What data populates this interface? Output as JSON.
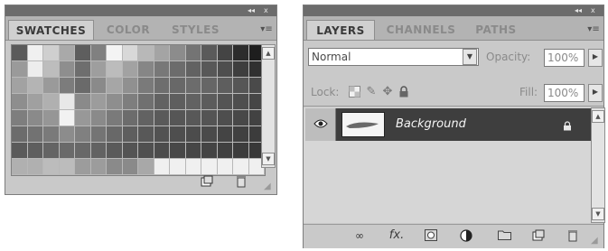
{
  "swatches_panel": {
    "collapse_glyph": "◂◂",
    "close_glyph": "x",
    "tabs": [
      {
        "label": "SWATCHES",
        "active": true
      },
      {
        "label": "COLOR",
        "active": false
      },
      {
        "label": "STYLES",
        "active": false
      }
    ],
    "menu_glyph": "▾≡",
    "swatch_gray_levels": [
      [
        "#5a5a5a",
        "#f0f0f0",
        "#cfcfcf",
        "#a9a9a9",
        "#5e5e5e",
        "#808080",
        "#f4f4f4",
        "#d8d8d8",
        "#b8b8b8",
        "#a4a4a4",
        "#8c8c8c",
        "#747474",
        "#5a5a5a",
        "#444444",
        "#2c2c2c",
        "#1e1e1e"
      ],
      [
        "#9a9a9a",
        "#ededed",
        "#bdbdbd",
        "#8e8e8e",
        "#6e6e6e",
        "#9e9e9e",
        "#bcbcbc",
        "#a2a2a2",
        "#868686",
        "#787878",
        "#6c6c6c",
        "#626262",
        "#585858",
        "#4e4e4e",
        "#3e3e3e",
        "#303030"
      ],
      [
        "#a2a2a2",
        "#b4b4b4",
        "#9a9a9a",
        "#7c7c7c",
        "#6a6a6a",
        "#8a8a8a",
        "#a6a6a6",
        "#909090",
        "#7a7a7a",
        "#6e6e6e",
        "#686868",
        "#6c6c6c",
        "#666666",
        "#5e5e5e",
        "#565656",
        "#4a4a4a"
      ],
      [
        "#8e8e8e",
        "#a0a0a0",
        "#b0b0b0",
        "#e8e8e8",
        "#8a8a8a",
        "#9c9c9c",
        "#8e8e8e",
        "#7e7e7e",
        "#707070",
        "#626262",
        "#5e5e5e",
        "#626262",
        "#5c5c5c",
        "#545454",
        "#4e4e4e",
        "#464646"
      ],
      [
        "#7e7e7e",
        "#8a8a8a",
        "#969696",
        "#f2f2f2",
        "#989898",
        "#8a8a8a",
        "#7a7a7a",
        "#6c6c6c",
        "#626262",
        "#5a5a5a",
        "#565656",
        "#585858",
        "#545454",
        "#4e4e4e",
        "#484848",
        "#424242"
      ],
      [
        "#6c6c6c",
        "#727272",
        "#7a7a7a",
        "#8c8c8c",
        "#808080",
        "#747474",
        "#686868",
        "#5e5e5e",
        "#585858",
        "#525252",
        "#4e4e4e",
        "#4c4c4c",
        "#4a4a4a",
        "#444444",
        "#404040",
        "#3c3c3c"
      ],
      [
        "#5a5a5a",
        "#5e5e5e",
        "#646464",
        "#6a6a6a",
        "#686868",
        "#626262",
        "#5a5a5a",
        "#545454",
        "#505050",
        "#4c4c4c",
        "#484848",
        "#464646",
        "#444444",
        "#404040",
        "#3c3c3c",
        "#383838"
      ],
      [
        "#b0b0b0",
        "#b0b0b0",
        "#bcbcbc",
        "#bcbcbc",
        "#9c9c9c",
        "#9c9c9c",
        "#8a8a8a",
        "#8a8a8a",
        "#a8a8a8",
        "#f0f0f0",
        "#f0f0f0",
        "#f0f0f0",
        "#f0f0f0",
        "#f0f0f0",
        "#f0f0f0",
        "#f0f0f0"
      ]
    ],
    "footer_icons": [
      "new-swatch-icon",
      "trash-icon"
    ]
  },
  "layers_panel": {
    "collapse_glyph": "◂◂",
    "close_glyph": "x",
    "tabs": [
      {
        "label": "LAYERS",
        "active": true
      },
      {
        "label": "CHANNELS",
        "active": false
      },
      {
        "label": "PATHS",
        "active": false
      }
    ],
    "menu_glyph": "▾≡",
    "blend_mode": "Normal",
    "opacity_label": "Opacity:",
    "opacity_value": "100%",
    "lock_label": "Lock:",
    "fill_label": "Fill:",
    "fill_value": "100%",
    "layers": [
      {
        "name": "Background",
        "visible": true,
        "locked": true
      }
    ],
    "footer_icons": [
      "link-layers-icon",
      "fx-icon",
      "mask-icon",
      "adjustment-icon",
      "group-icon",
      "new-layer-icon",
      "trash-icon"
    ],
    "fx_label": "fx."
  },
  "colors": {
    "panel_bg": "#c9c9c9",
    "titlebar": "#6c6c6c",
    "selected_layer": "#3e3e3e"
  }
}
